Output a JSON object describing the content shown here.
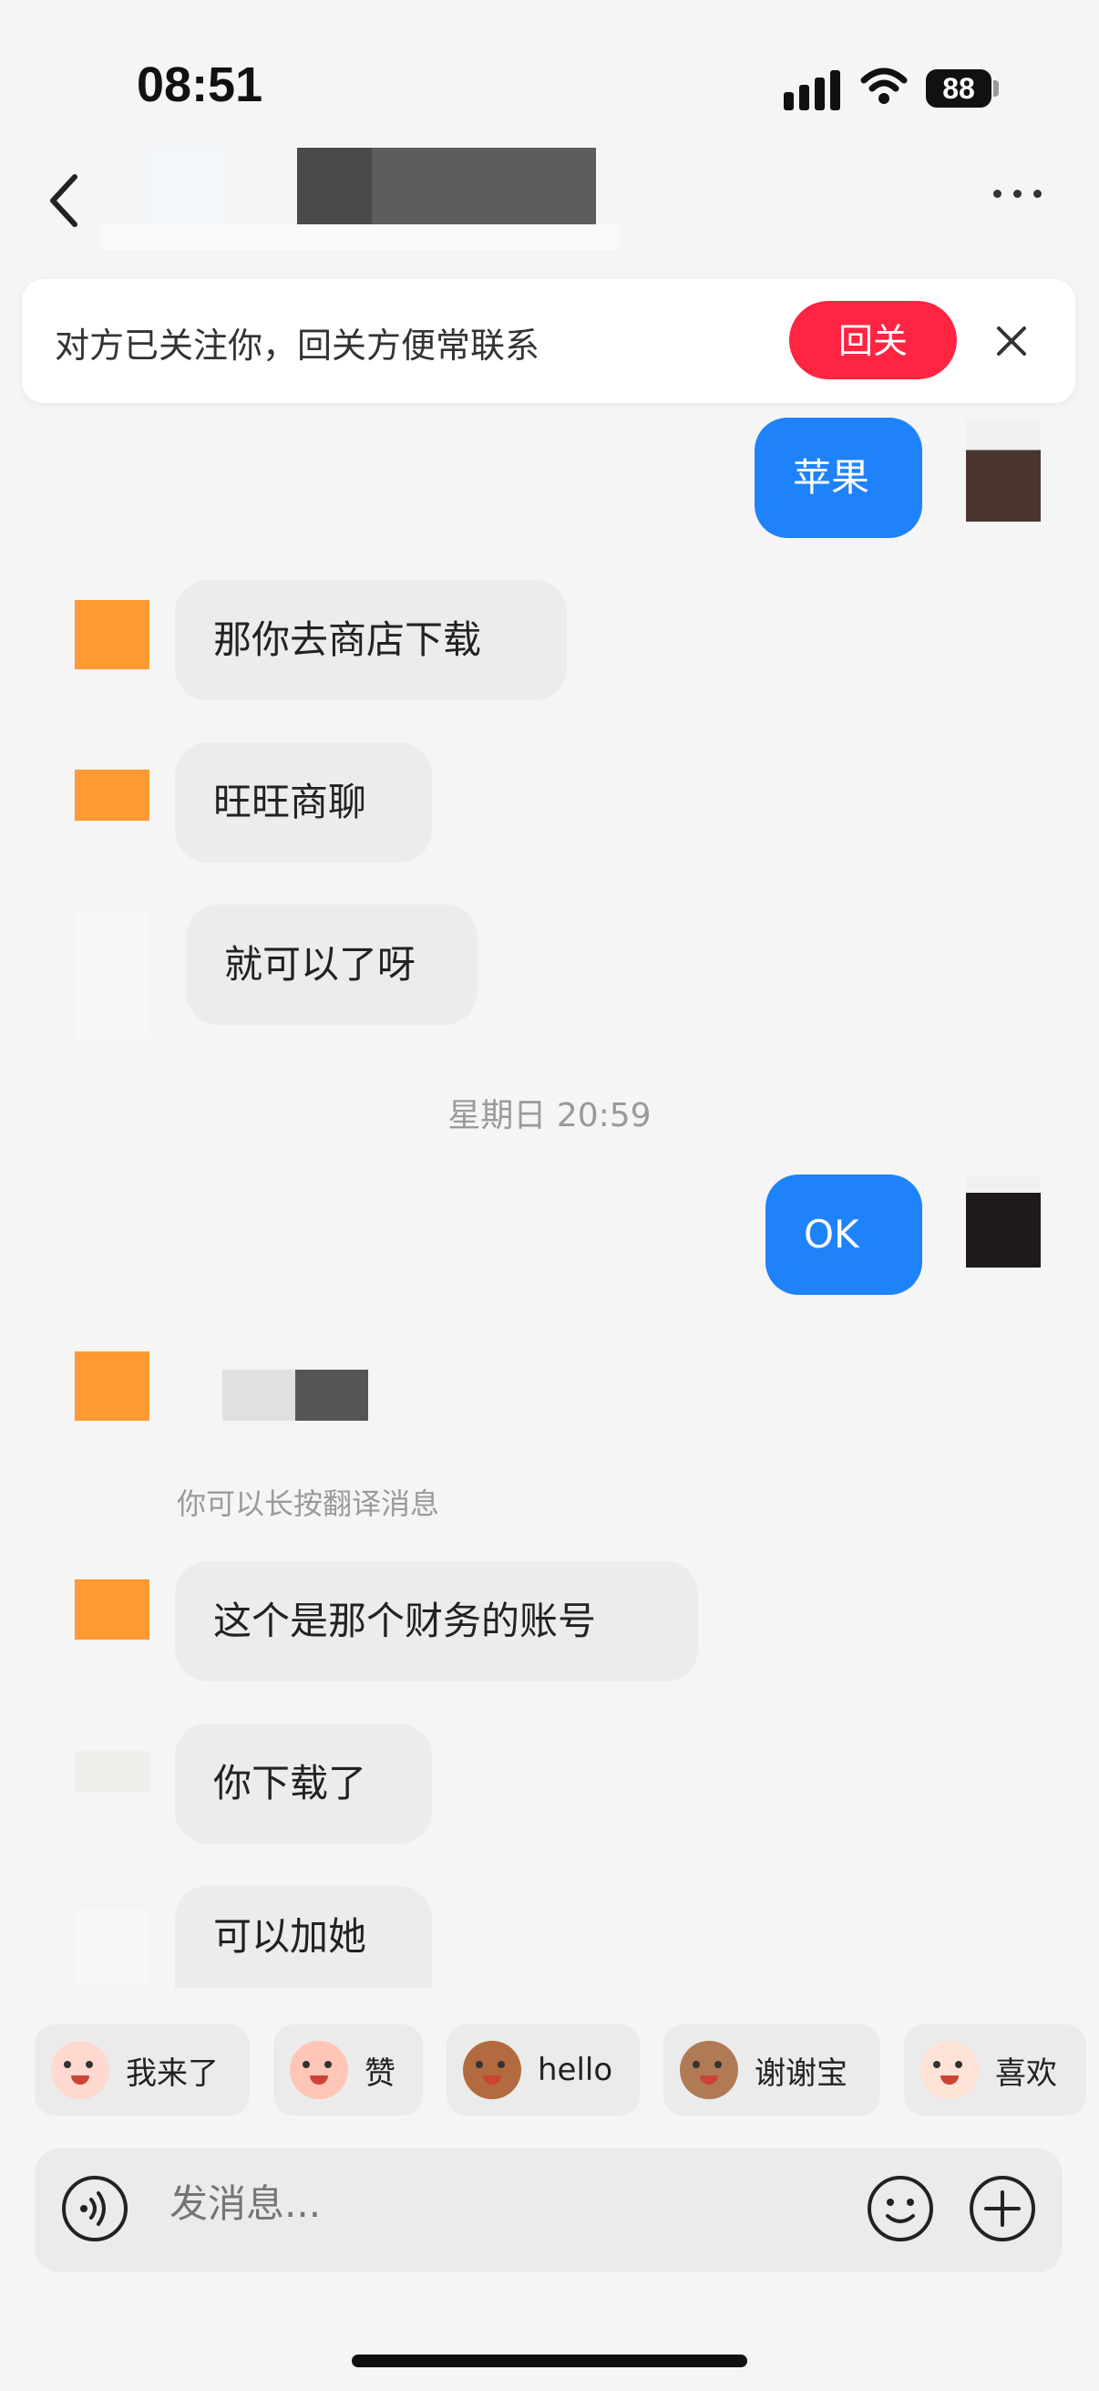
{
  "status_bar": {
    "time": "08:51",
    "battery": "88"
  },
  "nav": {
    "back_icon": "chevron-left-icon",
    "more_icon": "more-dots-icon"
  },
  "follow_banner": {
    "text": "对方已关注你，回关方便常联系",
    "button": "回关"
  },
  "messages": [
    {
      "side": "out",
      "text": "苹果"
    },
    {
      "side": "in",
      "text": "那你去商店下载"
    },
    {
      "side": "in",
      "text": "旺旺商聊"
    },
    {
      "side": "in",
      "text": "就可以了呀"
    },
    {
      "side": "out",
      "text": "OK"
    },
    {
      "side": "in",
      "text": ""
    },
    {
      "side": "in",
      "text": "这个是那个财务的账号"
    },
    {
      "side": "in",
      "text": "你下载了"
    },
    {
      "side": "in",
      "text": "可以加她"
    }
  ],
  "timestamp": "星期日 20:59",
  "translate_hint": "你可以长按翻译消息",
  "quick_replies": [
    {
      "label": "我来了",
      "color": "#ffd8cf"
    },
    {
      "label": "赞",
      "color": "#ffc6b8"
    },
    {
      "label": "hello",
      "color": "#b26a3e"
    },
    {
      "label": "谢谢宝",
      "color": "#b07a55"
    },
    {
      "label": "喜欢",
      "color": "#ffe2d6"
    }
  ],
  "input": {
    "placeholder": "发消息..."
  },
  "colors": {
    "accent_blue": "#1e82fa",
    "follow_red": "#ff2442",
    "avatar_orange": "#ff9933"
  }
}
